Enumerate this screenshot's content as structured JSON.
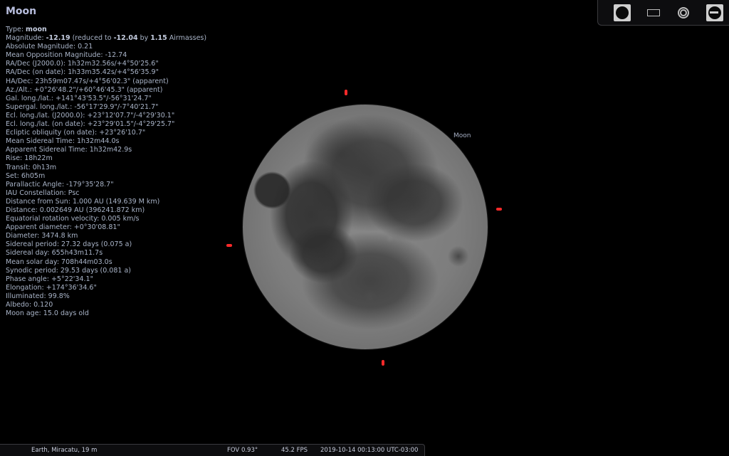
{
  "object": {
    "name": "Moon",
    "label": "Moon"
  },
  "info": {
    "type_prefix": "Type: ",
    "type_value": "moon",
    "mag_prefix": "Magnitude: ",
    "mag_value": "-12.19",
    "mag_reduced_prefix": " (reduced to ",
    "mag_reduced_value": "-12.04",
    "mag_by": " by ",
    "mag_airmass_value": "1.15",
    "mag_airmass_suffix": " Airmasses)",
    "lines": [
      "Absolute Magnitude: 0.21",
      "Mean Opposition Magnitude: -12.74",
      "RA/Dec (J2000.0): 1h32m32.56s/+4°50'25.6\"",
      "RA/Dec (on date): 1h33m35.42s/+4°56'35.9\"",
      "HA/Dec: 23h59m07.47s/+4°56'02.3\" (apparent)",
      "Az./Alt.: +0°26'48.2\"/+60°46'45.3\" (apparent)",
      "Gal. long./lat.: +141°43'53.5\"/-56°31'24.7\"",
      "Supergal. long./lat.: -56°17'29.9\"/-7°40'21.7\"",
      "Ecl. long./lat. (J2000.0): +23°12'07.7\"/-4°29'30.1\"",
      "Ecl. long./lat. (on date): +23°29'01.5\"/-4°29'25.7\"",
      "Ecliptic obliquity (on date): +23°26'10.7\"",
      "Mean Sidereal Time: 1h32m44.0s",
      "Apparent Sidereal Time: 1h32m42.9s",
      "Rise: 18h22m",
      "Transit: 0h13m",
      "Set: 6h05m",
      "Parallactic Angle: -179°35'28.7\"",
      "IAU Constellation: Psc",
      "Distance from Sun: 1.000 AU (149.639 M km)",
      "Distance: 0.002649 AU (396241.872 km)",
      "Equatorial rotation velocity: 0.005 km/s",
      "Apparent diameter: +0°30'08.81\"",
      "Diameter: 3474.8 km",
      "Sidereal period: 27.32 days (0.075 a)",
      "Sidereal day: 655h43m11.7s",
      "Mean solar day: 708h44m03.0s",
      "Synodic period: 29.53 days (0.081 a)",
      "Phase angle: +5°22'34.1\"",
      "Elongation: +174°36'34.6\"",
      "Illuminated: 99.8%",
      "Albedo: 0.120",
      "Moon age: 15.0 days old"
    ]
  },
  "toolbar": {
    "icons": [
      "moon-disc-icon",
      "ocular-rect-icon",
      "telrad-icon",
      "telescope-icon"
    ]
  },
  "status_bar": {
    "location": "Earth, Miracatu, 19 m",
    "fov": "FOV 0.93°",
    "fps": "45.2 FPS",
    "datetime": "2019-10-14 00:13:00 UTC-03:00"
  },
  "colors": {
    "background": "#000000",
    "info_text": "#a9b4c8",
    "pointer": "#ff2a2a",
    "moon": "#7d7d7d"
  }
}
